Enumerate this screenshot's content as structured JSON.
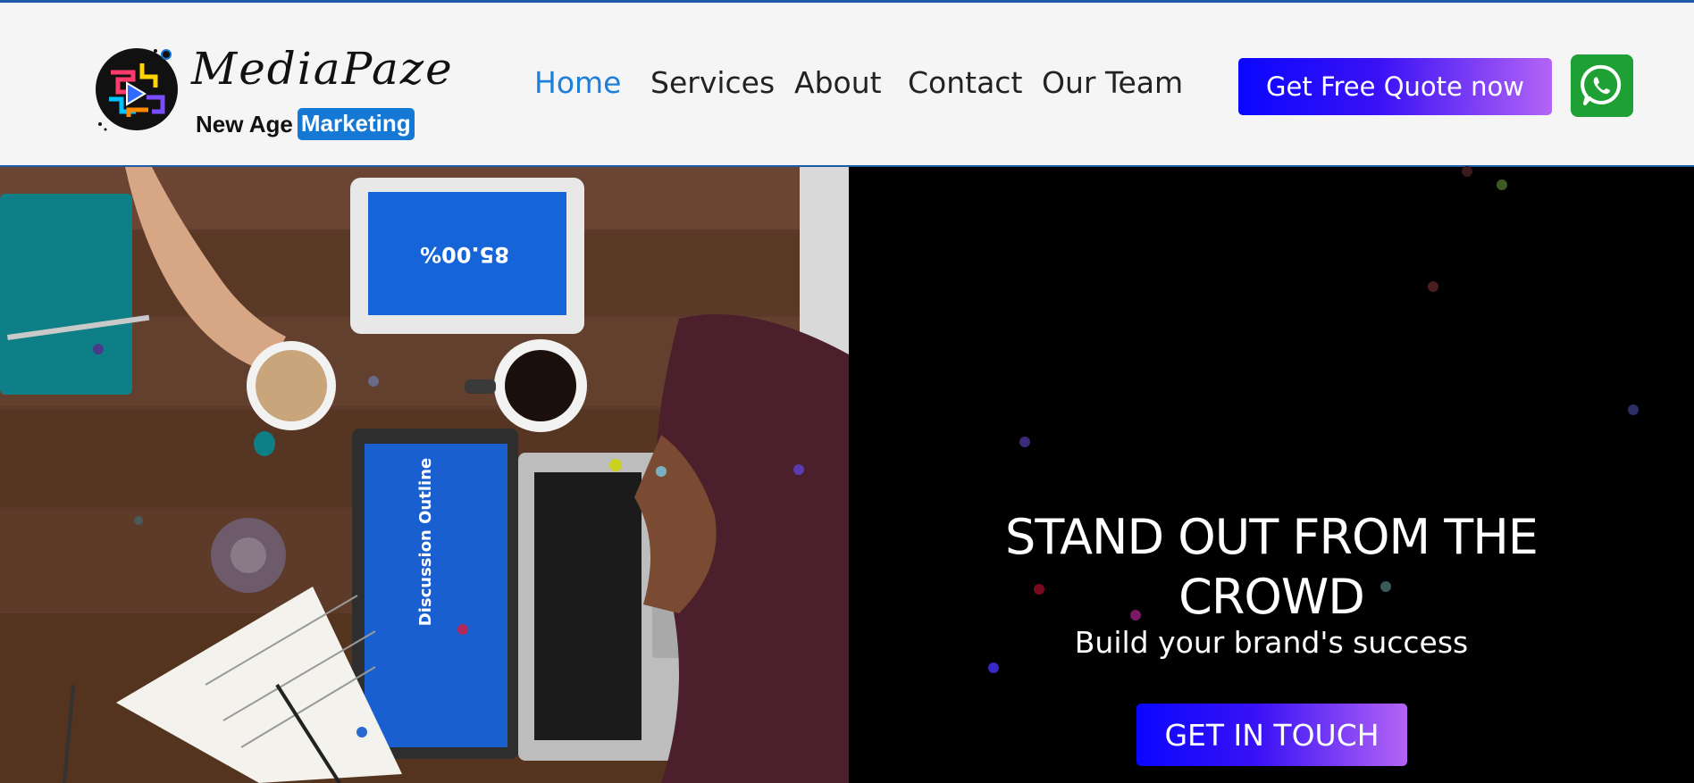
{
  "brand": {
    "name": "MediaPaze",
    "tagline_prefix": "New Age",
    "tagline_highlight": "Marketing"
  },
  "nav": {
    "items": [
      {
        "label": "Home",
        "active": true
      },
      {
        "label": "Services",
        "active": false
      },
      {
        "label": "About",
        "active": false
      },
      {
        "label": "Contact",
        "active": false
      },
      {
        "label": "Our Team",
        "active": false
      }
    ]
  },
  "header_actions": {
    "quote_label": "Get Free Quote now",
    "whatsapp_icon": "whatsapp-icon"
  },
  "hero": {
    "title": "STAND OUT FROM THE CROWD",
    "subtitle": "Build your brand's success",
    "cta_label": "GET IN TOUCH",
    "image_text": {
      "tablet_value": "85.00%",
      "laptop_title": "Discussion Outline"
    }
  },
  "colors": {
    "accent": "#1f7fd8",
    "gradient_start": "#0a06ff",
    "gradient_end": "#b464f5",
    "whatsapp": "#1ea034",
    "header_border": "#1e5aa8"
  }
}
